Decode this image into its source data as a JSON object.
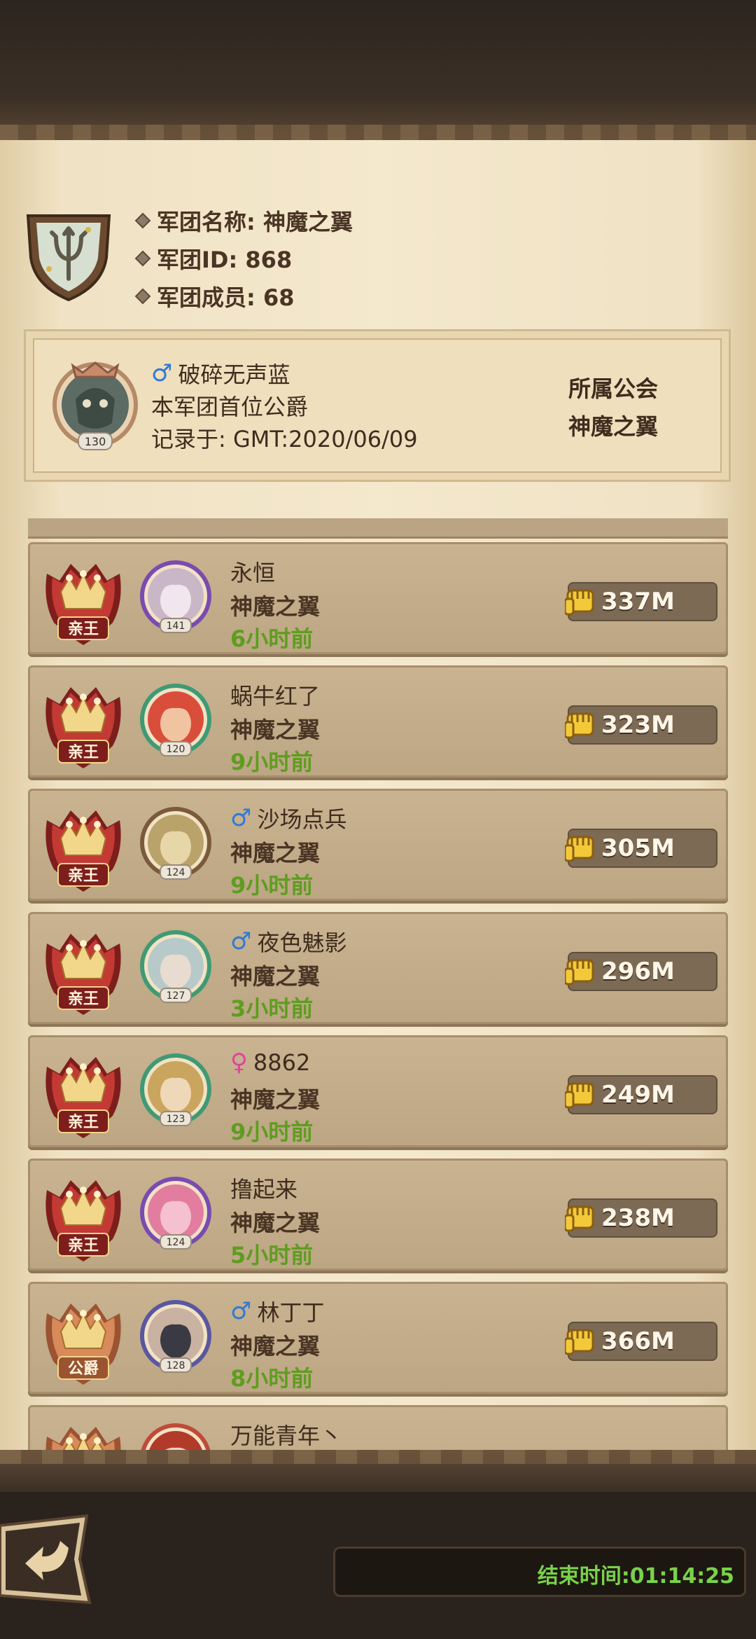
{
  "header": {
    "name_line": "军团名称: 神魔之翼",
    "id_line": "军团ID: 868",
    "members_line": "军团成员: 68"
  },
  "founder": {
    "gender": "male",
    "name": "破碎无声蓝",
    "level": "130",
    "title": "本军团首位公爵",
    "record": "记录于: GMT:2020/06/09",
    "guild_label": "所属公会",
    "guild_name": "神魔之翼"
  },
  "members": [
    {
      "rank": "亲王",
      "level": "141",
      "gender": "",
      "name": "永恒",
      "guild": "神魔之翼",
      "time": "6小时前",
      "power": "337M"
    },
    {
      "rank": "亲王",
      "level": "120",
      "gender": "",
      "name": "蜗牛红了",
      "guild": "神魔之翼",
      "time": "9小时前",
      "power": "323M"
    },
    {
      "rank": "亲王",
      "level": "124",
      "gender": "male",
      "name": "沙场点兵",
      "guild": "神魔之翼",
      "time": "9小时前",
      "power": "305M"
    },
    {
      "rank": "亲王",
      "level": "127",
      "gender": "male",
      "name": "夜色魅影",
      "guild": "神魔之翼",
      "time": "3小时前",
      "power": "296M"
    },
    {
      "rank": "亲王",
      "level": "123",
      "gender": "female",
      "name": "8862",
      "guild": "神魔之翼",
      "time": "9小时前",
      "power": "249M"
    },
    {
      "rank": "亲王",
      "level": "124",
      "gender": "",
      "name": "撸起来",
      "guild": "神魔之翼",
      "time": "5小时前",
      "power": "238M"
    },
    {
      "rank": "公爵",
      "level": "128",
      "gender": "male",
      "name": "林丁丁",
      "guild": "神魔之翼",
      "time": "8小时前",
      "power": "366M"
    },
    {
      "rank": "",
      "level": "",
      "gender": "",
      "name": "万能青年丶",
      "guild": "",
      "time": "",
      "power": ""
    }
  ],
  "footer": {
    "timer": "结束时间:01:14:25"
  },
  "colors": {
    "parchment": "#f4e8cd",
    "card": "#c9b390",
    "time_green": "#5e9d1f",
    "timer_green": "#79d24a",
    "male_blue": "#2f7ad6",
    "female_pink": "#e0449a"
  }
}
